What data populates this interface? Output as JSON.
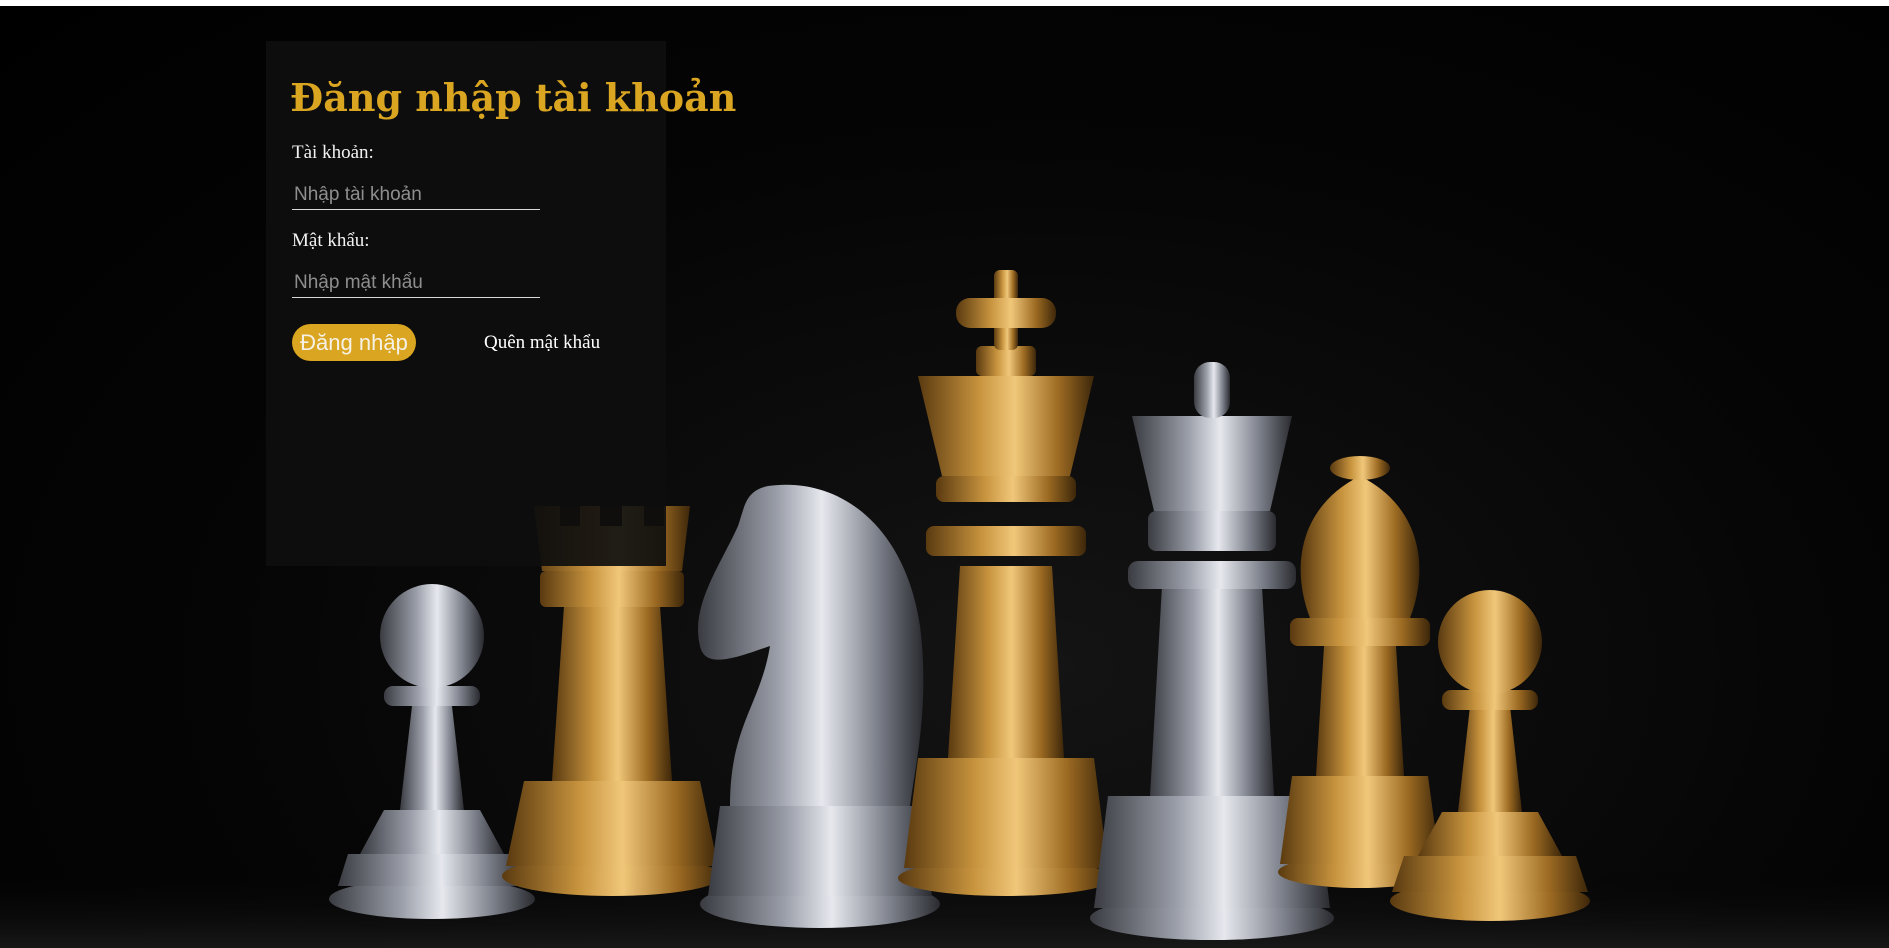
{
  "page": {
    "background_color": "#000000",
    "accent_color": "#daa520",
    "background_image": "chess-pieces-photo"
  },
  "login": {
    "title": "Đăng nhập tài khoản",
    "username_label": "Tài khoản:",
    "username_placeholder": "Nhập tài khoản",
    "username_value": "",
    "password_label": "Mật khẩu:",
    "password_placeholder": "Nhập mật khẩu",
    "password_value": "",
    "submit_label": "Đăng nhập",
    "forgot_label": "Quên mật khẩu"
  }
}
